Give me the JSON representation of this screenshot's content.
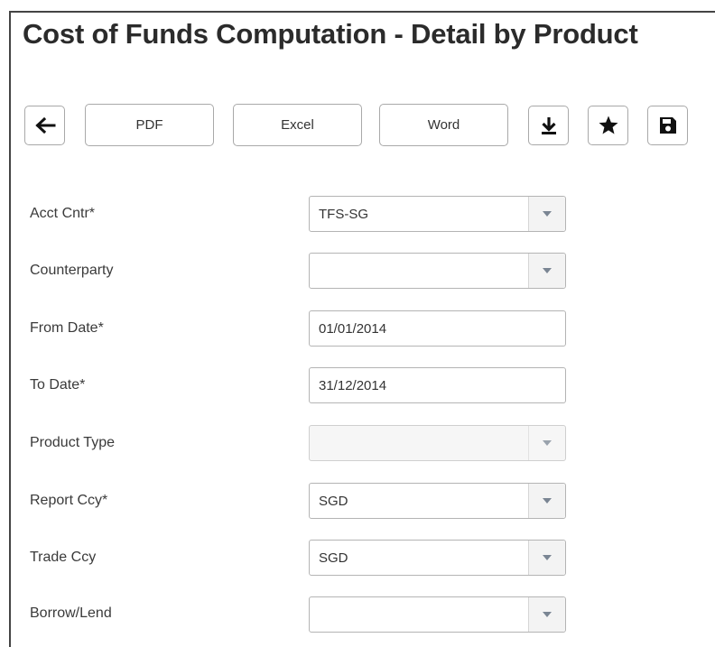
{
  "page": {
    "title": "Cost of Funds Computation - Detail by Product"
  },
  "toolbar": {
    "pdf_label": "PDF",
    "excel_label": "Excel",
    "word_label": "Word",
    "icons": {
      "back": "arrow-left-icon",
      "download": "download-icon",
      "favorite": "star-icon",
      "save": "floppy-disk-icon"
    }
  },
  "form": {
    "acct_cntr": {
      "label": "Acct Cntr*",
      "value": "TFS-SG"
    },
    "counterparty": {
      "label": "Counterparty",
      "value": ""
    },
    "from_date": {
      "label": "From Date*",
      "value": "01/01/2014"
    },
    "to_date": {
      "label": "To Date*",
      "value": "31/12/2014"
    },
    "product_type": {
      "label": "Product Type",
      "value": ""
    },
    "report_ccy": {
      "label": "Report Ccy*",
      "value": "SGD"
    },
    "trade_ccy": {
      "label": "Trade Ccy",
      "value": "SGD"
    },
    "borrow_lend": {
      "label": "Borrow/Lend",
      "value": ""
    }
  },
  "colors": {
    "text": "#333333",
    "border": "#a9a9a9",
    "frame": "#444444"
  }
}
